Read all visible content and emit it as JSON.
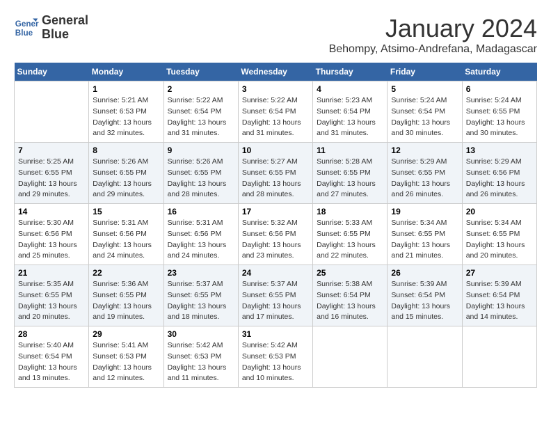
{
  "header": {
    "logo_line1": "General",
    "logo_line2": "Blue",
    "month": "January 2024",
    "location": "Behompy, Atsimo-Andrefana, Madagascar"
  },
  "weekdays": [
    "Sunday",
    "Monday",
    "Tuesday",
    "Wednesday",
    "Thursday",
    "Friday",
    "Saturday"
  ],
  "weeks": [
    [
      {
        "day": "",
        "sunrise": "",
        "sunset": "",
        "daylight": ""
      },
      {
        "day": "1",
        "sunrise": "Sunrise: 5:21 AM",
        "sunset": "Sunset: 6:53 PM",
        "daylight": "Daylight: 13 hours and 32 minutes."
      },
      {
        "day": "2",
        "sunrise": "Sunrise: 5:22 AM",
        "sunset": "Sunset: 6:54 PM",
        "daylight": "Daylight: 13 hours and 31 minutes."
      },
      {
        "day": "3",
        "sunrise": "Sunrise: 5:22 AM",
        "sunset": "Sunset: 6:54 PM",
        "daylight": "Daylight: 13 hours and 31 minutes."
      },
      {
        "day": "4",
        "sunrise": "Sunrise: 5:23 AM",
        "sunset": "Sunset: 6:54 PM",
        "daylight": "Daylight: 13 hours and 31 minutes."
      },
      {
        "day": "5",
        "sunrise": "Sunrise: 5:24 AM",
        "sunset": "Sunset: 6:54 PM",
        "daylight": "Daylight: 13 hours and 30 minutes."
      },
      {
        "day": "6",
        "sunrise": "Sunrise: 5:24 AM",
        "sunset": "Sunset: 6:55 PM",
        "daylight": "Daylight: 13 hours and 30 minutes."
      }
    ],
    [
      {
        "day": "7",
        "sunrise": "Sunrise: 5:25 AM",
        "sunset": "Sunset: 6:55 PM",
        "daylight": "Daylight: 13 hours and 29 minutes."
      },
      {
        "day": "8",
        "sunrise": "Sunrise: 5:26 AM",
        "sunset": "Sunset: 6:55 PM",
        "daylight": "Daylight: 13 hours and 29 minutes."
      },
      {
        "day": "9",
        "sunrise": "Sunrise: 5:26 AM",
        "sunset": "Sunset: 6:55 PM",
        "daylight": "Daylight: 13 hours and 28 minutes."
      },
      {
        "day": "10",
        "sunrise": "Sunrise: 5:27 AM",
        "sunset": "Sunset: 6:55 PM",
        "daylight": "Daylight: 13 hours and 28 minutes."
      },
      {
        "day": "11",
        "sunrise": "Sunrise: 5:28 AM",
        "sunset": "Sunset: 6:55 PM",
        "daylight": "Daylight: 13 hours and 27 minutes."
      },
      {
        "day": "12",
        "sunrise": "Sunrise: 5:29 AM",
        "sunset": "Sunset: 6:55 PM",
        "daylight": "Daylight: 13 hours and 26 minutes."
      },
      {
        "day": "13",
        "sunrise": "Sunrise: 5:29 AM",
        "sunset": "Sunset: 6:56 PM",
        "daylight": "Daylight: 13 hours and 26 minutes."
      }
    ],
    [
      {
        "day": "14",
        "sunrise": "Sunrise: 5:30 AM",
        "sunset": "Sunset: 6:56 PM",
        "daylight": "Daylight: 13 hours and 25 minutes."
      },
      {
        "day": "15",
        "sunrise": "Sunrise: 5:31 AM",
        "sunset": "Sunset: 6:56 PM",
        "daylight": "Daylight: 13 hours and 24 minutes."
      },
      {
        "day": "16",
        "sunrise": "Sunrise: 5:31 AM",
        "sunset": "Sunset: 6:56 PM",
        "daylight": "Daylight: 13 hours and 24 minutes."
      },
      {
        "day": "17",
        "sunrise": "Sunrise: 5:32 AM",
        "sunset": "Sunset: 6:56 PM",
        "daylight": "Daylight: 13 hours and 23 minutes."
      },
      {
        "day": "18",
        "sunrise": "Sunrise: 5:33 AM",
        "sunset": "Sunset: 6:55 PM",
        "daylight": "Daylight: 13 hours and 22 minutes."
      },
      {
        "day": "19",
        "sunrise": "Sunrise: 5:34 AM",
        "sunset": "Sunset: 6:55 PM",
        "daylight": "Daylight: 13 hours and 21 minutes."
      },
      {
        "day": "20",
        "sunrise": "Sunrise: 5:34 AM",
        "sunset": "Sunset: 6:55 PM",
        "daylight": "Daylight: 13 hours and 20 minutes."
      }
    ],
    [
      {
        "day": "21",
        "sunrise": "Sunrise: 5:35 AM",
        "sunset": "Sunset: 6:55 PM",
        "daylight": "Daylight: 13 hours and 20 minutes."
      },
      {
        "day": "22",
        "sunrise": "Sunrise: 5:36 AM",
        "sunset": "Sunset: 6:55 PM",
        "daylight": "Daylight: 13 hours and 19 minutes."
      },
      {
        "day": "23",
        "sunrise": "Sunrise: 5:37 AM",
        "sunset": "Sunset: 6:55 PM",
        "daylight": "Daylight: 13 hours and 18 minutes."
      },
      {
        "day": "24",
        "sunrise": "Sunrise: 5:37 AM",
        "sunset": "Sunset: 6:55 PM",
        "daylight": "Daylight: 13 hours and 17 minutes."
      },
      {
        "day": "25",
        "sunrise": "Sunrise: 5:38 AM",
        "sunset": "Sunset: 6:54 PM",
        "daylight": "Daylight: 13 hours and 16 minutes."
      },
      {
        "day": "26",
        "sunrise": "Sunrise: 5:39 AM",
        "sunset": "Sunset: 6:54 PM",
        "daylight": "Daylight: 13 hours and 15 minutes."
      },
      {
        "day": "27",
        "sunrise": "Sunrise: 5:39 AM",
        "sunset": "Sunset: 6:54 PM",
        "daylight": "Daylight: 13 hours and 14 minutes."
      }
    ],
    [
      {
        "day": "28",
        "sunrise": "Sunrise: 5:40 AM",
        "sunset": "Sunset: 6:54 PM",
        "daylight": "Daylight: 13 hours and 13 minutes."
      },
      {
        "day": "29",
        "sunrise": "Sunrise: 5:41 AM",
        "sunset": "Sunset: 6:53 PM",
        "daylight": "Daylight: 13 hours and 12 minutes."
      },
      {
        "day": "30",
        "sunrise": "Sunrise: 5:42 AM",
        "sunset": "Sunset: 6:53 PM",
        "daylight": "Daylight: 13 hours and 11 minutes."
      },
      {
        "day": "31",
        "sunrise": "Sunrise: 5:42 AM",
        "sunset": "Sunset: 6:53 PM",
        "daylight": "Daylight: 13 hours and 10 minutes."
      },
      {
        "day": "",
        "sunrise": "",
        "sunset": "",
        "daylight": ""
      },
      {
        "day": "",
        "sunrise": "",
        "sunset": "",
        "daylight": ""
      },
      {
        "day": "",
        "sunrise": "",
        "sunset": "",
        "daylight": ""
      }
    ]
  ]
}
